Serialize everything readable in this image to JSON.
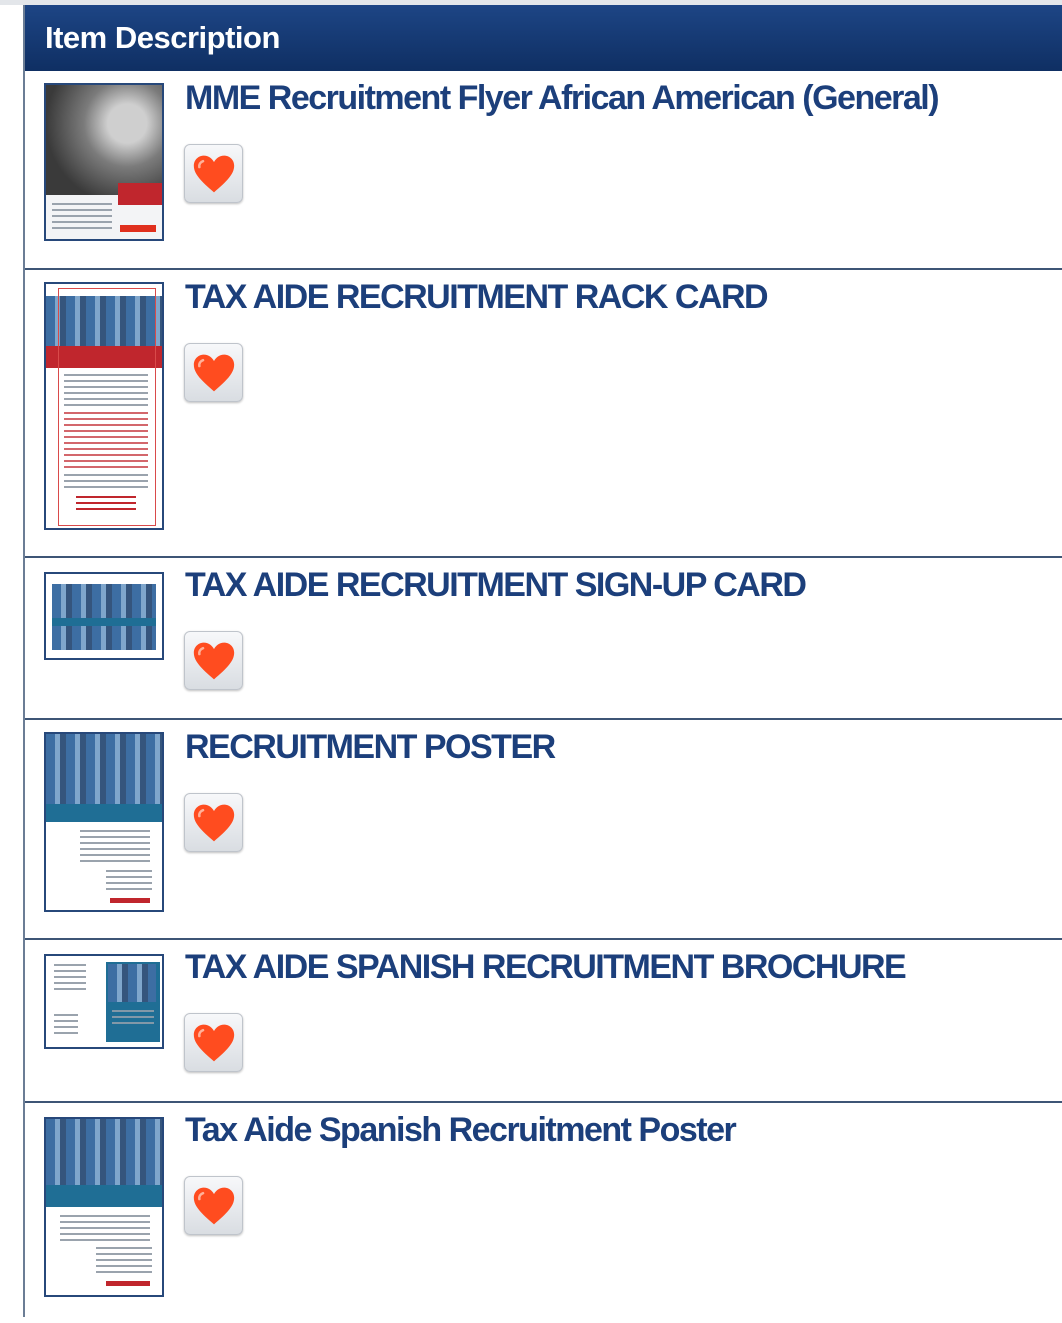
{
  "table": {
    "header": "Item Description",
    "items": [
      {
        "title": "MME Recruitment Flyer African American (General)",
        "thumb_icon": "flyer-thumbnail",
        "favorite_icon": "heart-icon"
      },
      {
        "title": "TAX AIDE RECRUITMENT RACK CARD",
        "thumb_icon": "rack-card-thumbnail",
        "favorite_icon": "heart-icon"
      },
      {
        "title": "TAX AIDE RECRUITMENT SIGN-UP CARD",
        "thumb_icon": "sign-up-card-thumbnail",
        "favorite_icon": "heart-icon"
      },
      {
        "title": "RECRUITMENT POSTER",
        "thumb_icon": "poster-thumbnail",
        "favorite_icon": "heart-icon"
      },
      {
        "title": "TAX AIDE SPANISH RECRUITMENT BROCHURE",
        "thumb_icon": "brochure-thumbnail",
        "favorite_icon": "heart-icon"
      },
      {
        "title": "Tax Aide Spanish Recruitment Poster",
        "thumb_icon": "spanish-poster-thumbnail",
        "favorite_icon": "heart-icon"
      }
    ]
  },
  "colors": {
    "header_bg": "#163a73",
    "title_text": "#1c3f7b",
    "row_divider": "#3e5576",
    "heart": "#ff4c1f"
  }
}
